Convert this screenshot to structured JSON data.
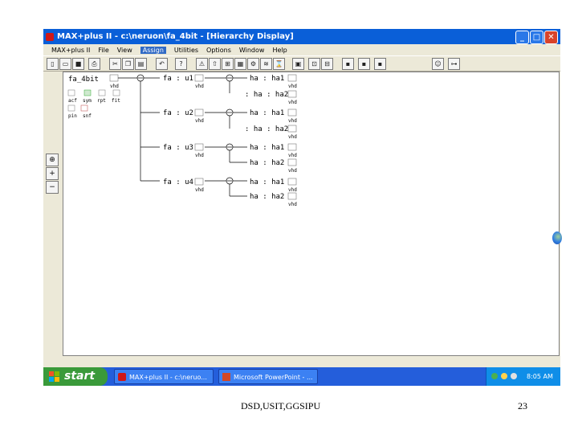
{
  "window": {
    "title": "MAX+plus II - c:\\neruon\\fa_4bit - [Hierarchy Display]",
    "controls": {
      "minimize": "_",
      "maximize": "□",
      "close": "✕"
    }
  },
  "menubar": {
    "items": [
      "MAX+plus II",
      "File",
      "View",
      "Assign",
      "Utilities",
      "Options",
      "Window",
      "Help"
    ],
    "active": "Assign"
  },
  "hierarchy": {
    "root": {
      "name": "fa_4bit",
      "file_label": "vhd",
      "extra_files": [
        "acf",
        "sym",
        "rpt",
        "fit",
        "pin",
        "snf"
      ]
    },
    "level1": [
      {
        "name": "fa : u1",
        "file_label": "vhd",
        "children": [
          "ha : ha1",
          ": ha : ha2"
        ]
      },
      {
        "name": "fa : u2",
        "file_label": "vhd",
        "children": [
          "ha : ha1",
          ": ha : ha2"
        ]
      },
      {
        "name": "fa : u3",
        "file_label": "vhd",
        "children": [
          "ha : ha1",
          "ha : ha2"
        ]
      },
      {
        "name": "fa : u4",
        "file_label": "vhd",
        "children": [
          "ha : ha1",
          "ha : ha2"
        ]
      }
    ],
    "leaf_file_label": "vhd"
  },
  "taskbar": {
    "start_label": "start",
    "tasks": [
      "MAX+plus II - c:\\neruo...",
      "Microsoft PowerPoint - ..."
    ],
    "clock": "8:05 AM"
  },
  "footer": {
    "center": "DSD,USIT,GGSIPU",
    "page": "23"
  },
  "colors": {
    "titlebar": "#0a5fd8",
    "taskbar": "#245edb",
    "start": "#3a9a3a",
    "menu_active": "#316ac5"
  }
}
